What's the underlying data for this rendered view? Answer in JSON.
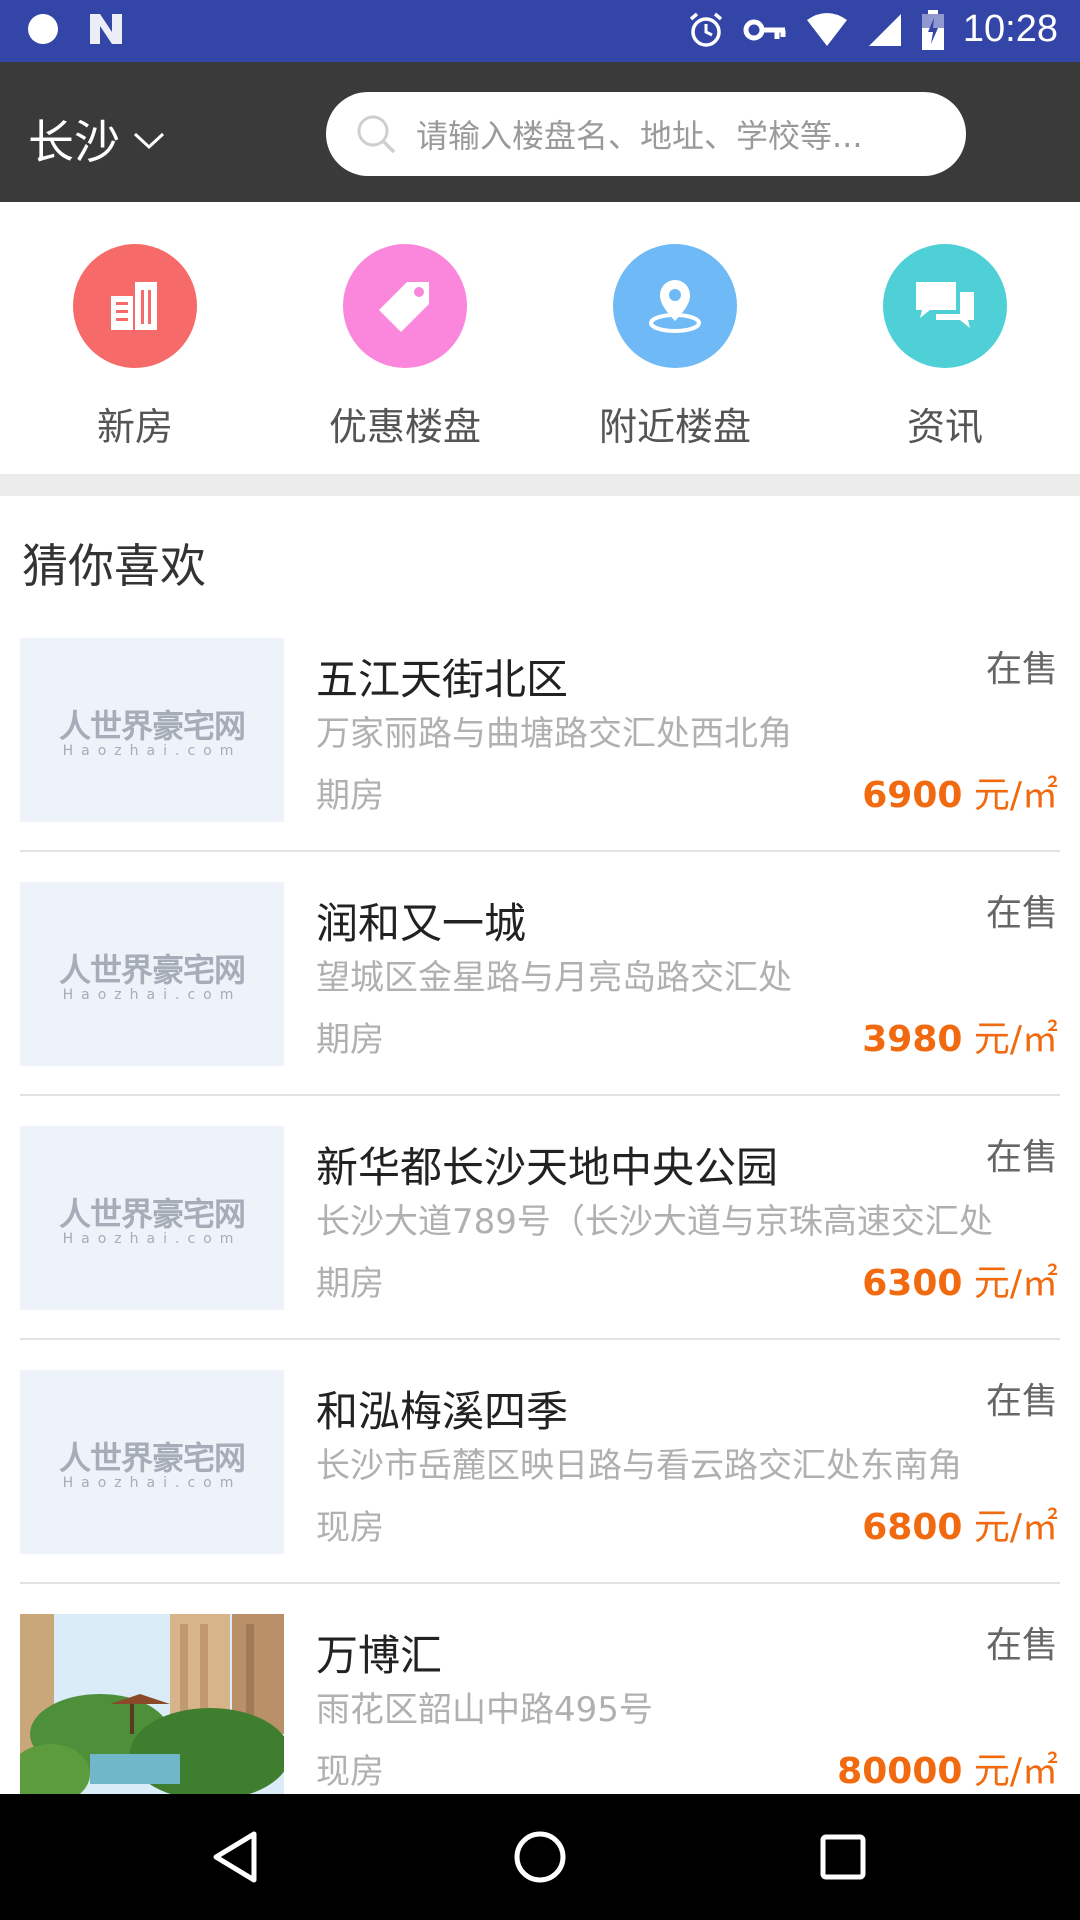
{
  "status_bar": {
    "time": "10:28",
    "icons": [
      "notification-dot-icon",
      "n-app-icon",
      "alarm-icon",
      "vpn-key-icon",
      "wifi-icon",
      "signal-icon",
      "battery-icon"
    ]
  },
  "header": {
    "city": "长沙",
    "search_placeholder": "请输入楼盘名、地址、学校等..."
  },
  "categories": [
    {
      "label": "新房",
      "icon": "building-icon",
      "color": "#f76a6a"
    },
    {
      "label": "优惠楼盘",
      "icon": "tag-icon",
      "color": "#fb87dc"
    },
    {
      "label": "附近楼盘",
      "icon": "location-pin-icon",
      "color": "#6fbaf6"
    },
    {
      "label": "资讯",
      "icon": "chat-bubbles-icon",
      "color": "#4fd0d6"
    }
  ],
  "section_title": "猜你喜欢",
  "placeholder_logo": {
    "line1": "人世界豪宅网",
    "line2": "Haozhai.com"
  },
  "listings": [
    {
      "name": "五江天街北区",
      "status": "在售",
      "address": "万家丽路与曲塘路交汇处西北角",
      "type": "期房",
      "price": "6900",
      "unit": " 元/㎡"
    },
    {
      "name": "润和又一城",
      "status": "在售",
      "address": "望城区金星路与月亮岛路交汇处",
      "type": "期房",
      "price": "3980",
      "unit": " 元/㎡"
    },
    {
      "name": "新华都长沙天地中央公园",
      "status": "在售",
      "address": "长沙大道789号（长沙大道与京珠高速交汇处",
      "type": "期房",
      "price": "6300",
      "unit": " 元/㎡"
    },
    {
      "name": "和泓梅溪四季",
      "status": "在售",
      "address": "长沙市岳麓区映日路与看云路交汇处东南角",
      "type": "现房",
      "price": "6800",
      "unit": " 元/㎡"
    },
    {
      "name": "万博汇",
      "status": "在售",
      "address": "雨花区韶山中路495号",
      "type": "现房",
      "price": "80000",
      "unit": " 元/㎡"
    }
  ],
  "colors": {
    "status_bar": "#3445a8",
    "header": "#3a3a3a",
    "price": "#f26a10"
  }
}
